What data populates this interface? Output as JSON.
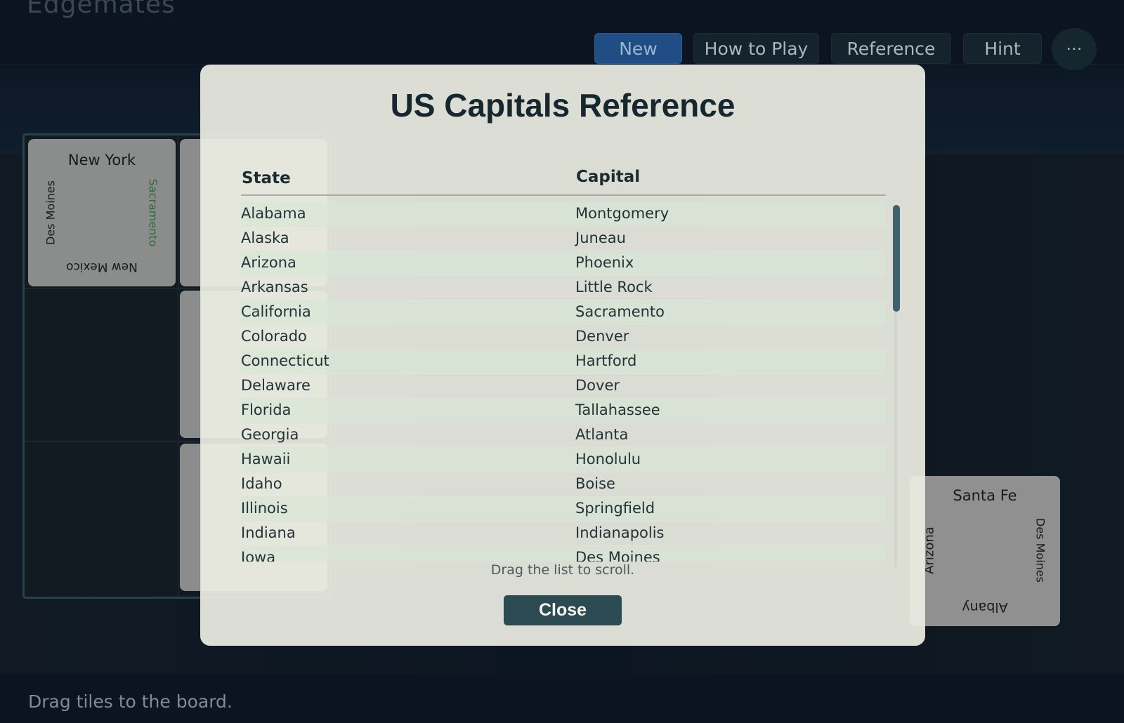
{
  "app": {
    "title": "Edgemates"
  },
  "toolbar": {
    "new_label": "New",
    "how_to_play_label": "How to Play",
    "reference_label": "Reference",
    "hint_label": "Hint",
    "more_label": "···"
  },
  "board": {
    "tile_new_york": {
      "top": "New York",
      "left": "Des Moines",
      "right": "Sacramento",
      "bottom": "New Mexico"
    }
  },
  "tray": {
    "tile_santa_fe": {
      "top": "Santa Fe",
      "left": "Arizona",
      "right": "Des Moines",
      "bottom": "Albany"
    }
  },
  "status": {
    "message": "Drag tiles to the board."
  },
  "modal": {
    "title": "US Capitals Reference",
    "state_header": "State",
    "capital_header": "Capital",
    "rows": [
      {
        "state": "Alabama",
        "capital": "Montgomery"
      },
      {
        "state": "Alaska",
        "capital": "Juneau"
      },
      {
        "state": "Arizona",
        "capital": "Phoenix"
      },
      {
        "state": "Arkansas",
        "capital": "Little Rock"
      },
      {
        "state": "California",
        "capital": "Sacramento"
      },
      {
        "state": "Colorado",
        "capital": "Denver"
      },
      {
        "state": "Connecticut",
        "capital": "Hartford"
      },
      {
        "state": "Delaware",
        "capital": "Dover"
      },
      {
        "state": "Florida",
        "capital": "Tallahassee"
      },
      {
        "state": "Georgia",
        "capital": "Atlanta"
      },
      {
        "state": "Hawaii",
        "capital": "Honolulu"
      },
      {
        "state": "Idaho",
        "capital": "Boise"
      },
      {
        "state": "Illinois",
        "capital": "Springfield"
      },
      {
        "state": "Indiana",
        "capital": "Indianapolis"
      },
      {
        "state": "Iowa",
        "capital": "Des Moines"
      }
    ],
    "scroll_hint": "Drag the list to scroll.",
    "close_label": "Close"
  }
}
